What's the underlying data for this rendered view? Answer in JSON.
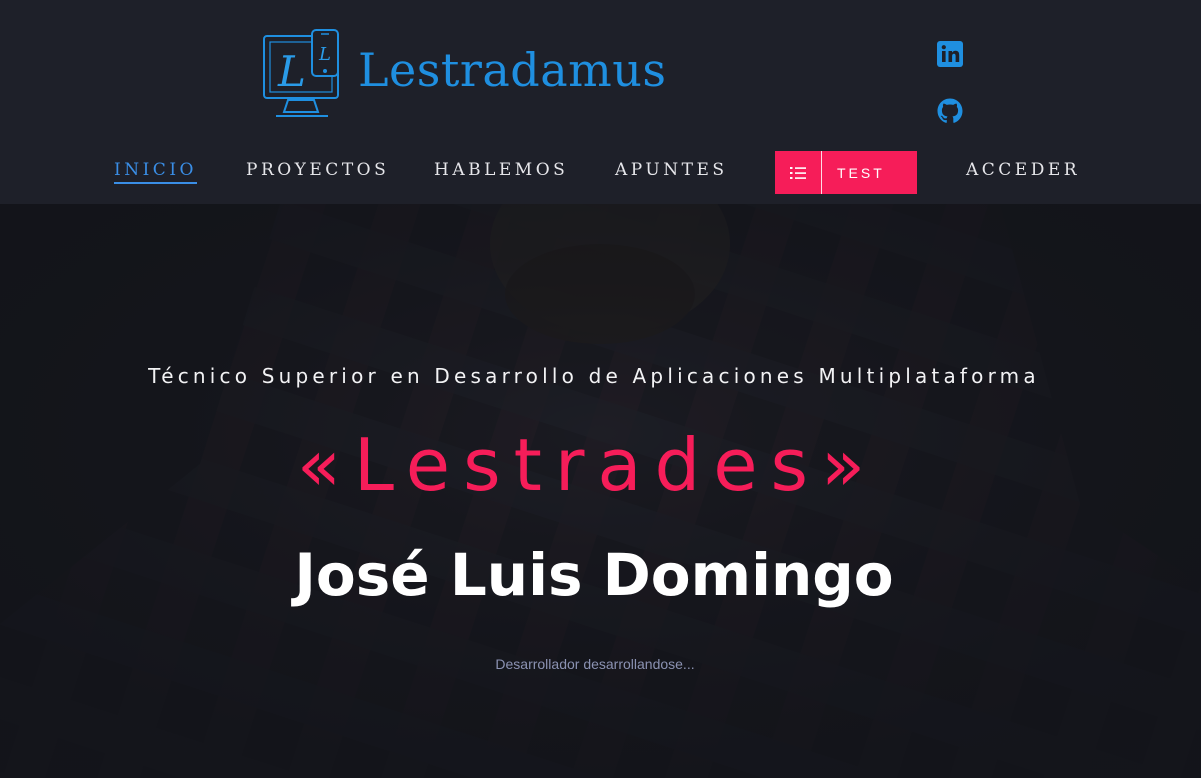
{
  "brand": {
    "name": "Lestradamus",
    "logo_letters": "L"
  },
  "social": [
    {
      "name": "LinkedIn",
      "icon": "linkedin-icon",
      "color": "#1f8fe0"
    },
    {
      "name": "GitHub",
      "icon": "github-icon",
      "color": "#1f8fe0"
    }
  ],
  "nav": {
    "items": [
      "INICIO",
      "PROYECTOS",
      "HABLEMOS",
      "APUNTES"
    ],
    "active": "INICIO",
    "test_label": "TEST",
    "test_icon": "list-ordered-icon",
    "login_label": "ACCEDER"
  },
  "hero": {
    "subtitle": "Técnico Superior en Desarrollo de Aplicaciones Multiplataforma",
    "nickname": "«Lestrades»",
    "name": "José Luis Domingo",
    "tagline": "Desarrollador desarrollandose..."
  },
  "colors": {
    "accent": "#f61d59",
    "brand_blue": "#1f8fe0",
    "header_bg": "#1e2029"
  }
}
